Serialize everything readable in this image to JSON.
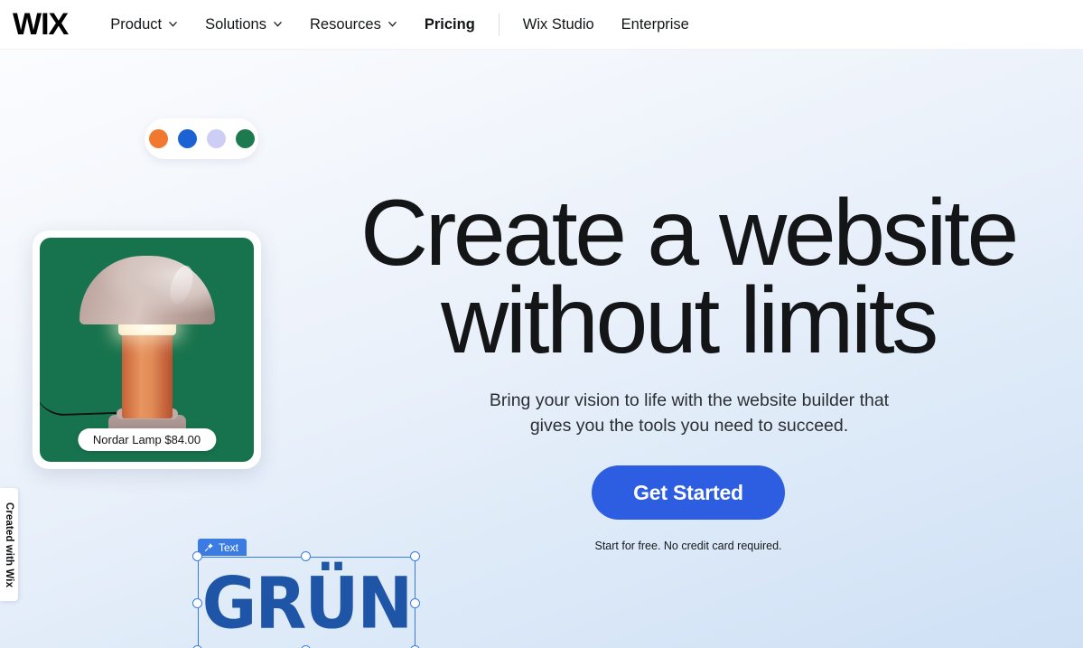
{
  "navbar": {
    "logo": "WIX",
    "items": [
      {
        "label": "Product",
        "has_chevron": true,
        "bold": false,
        "icon": "chevron-down-icon"
      },
      {
        "label": "Solutions",
        "has_chevron": true,
        "bold": false,
        "icon": "chevron-down-icon"
      },
      {
        "label": "Resources",
        "has_chevron": true,
        "bold": false,
        "icon": "chevron-down-icon"
      },
      {
        "label": "Pricing",
        "has_chevron": false,
        "bold": true,
        "icon": ""
      }
    ],
    "secondary_items": [
      {
        "label": "Wix Studio"
      },
      {
        "label": "Enterprise"
      }
    ]
  },
  "hero": {
    "headline_line1": "Create a website",
    "headline_line2": "without limits",
    "subhead_line1": "Bring your vision to life with the website builder that",
    "subhead_line2": "gives you the tools you need to succeed.",
    "cta_label": "Get Started",
    "cta_note": "Start for free. No credit card required.",
    "cta_color": "#2d5de0"
  },
  "swatches": {
    "colors": [
      {
        "name": "orange",
        "hex": "#f0792f"
      },
      {
        "name": "blue",
        "hex": "#1c62d4"
      },
      {
        "name": "lavender",
        "hex": "#cdcdf6"
      },
      {
        "name": "green",
        "hex": "#1d7a4e"
      }
    ]
  },
  "product_card": {
    "price_label": "Nordar Lamp $84.00",
    "background_color": "#17734d"
  },
  "created_tab": {
    "label": "Created with Wix"
  },
  "editor_selection": {
    "badge_label": "Text",
    "badge_icon": "pin-icon",
    "element_text": "GRÜN",
    "accent_color": "#3a7ce1"
  }
}
